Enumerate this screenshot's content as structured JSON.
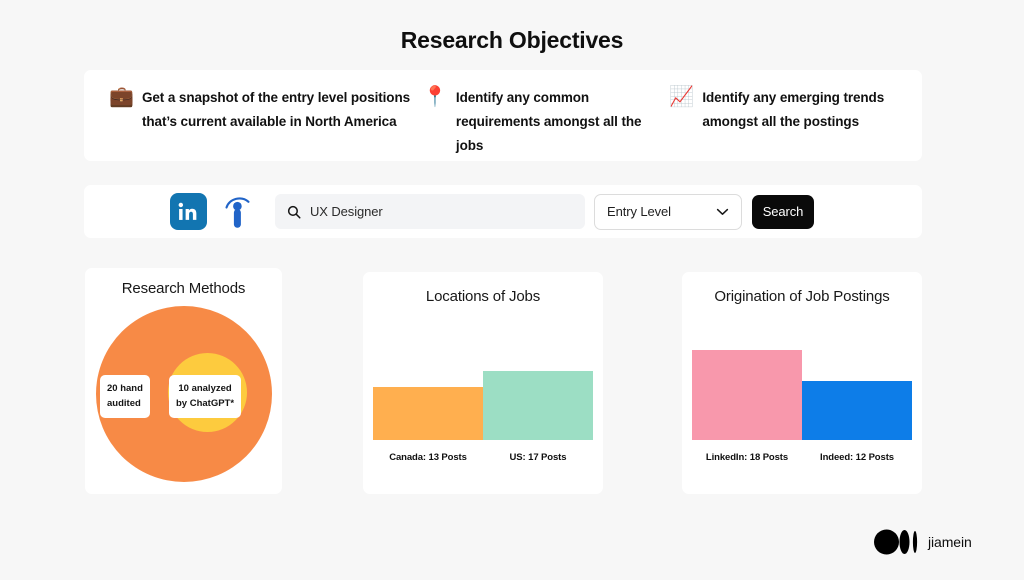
{
  "page": {
    "title": "Research Objectives",
    "background_color": "#F7F7F7"
  },
  "objectives": {
    "items": [
      {
        "icon": "briefcase-emoji",
        "glyph": "💼",
        "text": "Get a snapshot of the entry level positions that’s current available in North America"
      },
      {
        "icon": "pushpin-emoji",
        "glyph": "📍",
        "text": "Identify any common requirements amongst all the jobs"
      },
      {
        "icon": "chart-increasing-emoji",
        "glyph": "📈",
        "text": "Identify any emerging trends amongst all the postings"
      }
    ]
  },
  "search_bar": {
    "logos": [
      {
        "name": "linkedin-logo",
        "label": "in",
        "color": "#1275B1"
      },
      {
        "name": "indeed-logo",
        "label": "i",
        "color": "#2164C8"
      }
    ],
    "search_icon": "search-icon",
    "query_value": "UX Designer",
    "query_placeholder": "UX Designer",
    "level_selected": "Entry Level",
    "level_options": [
      "Entry Level"
    ],
    "chevron_icon": "chevron-down-icon",
    "search_button_label": "Search"
  },
  "chart_data": [
    {
      "type": "pie",
      "name": "research-methods",
      "title": "Research Methods",
      "categories": [
        "20 hand audited",
        "10 analyzed by ChatGPT*"
      ],
      "values": [
        20,
        10
      ],
      "labels": [
        "20 hand\naudited",
        "10 analyzed\nby ChatGPT*"
      ],
      "colors": [
        "#F78A46",
        "#FDCB3E"
      ],
      "layout": "nested-circles",
      "legend": "inline-labels",
      "grid": false
    },
    {
      "type": "bar",
      "name": "locations-of-jobs",
      "title": "Locations of Jobs",
      "categories": [
        "Canada",
        "US"
      ],
      "values": [
        13,
        17
      ],
      "labels": [
        "Canada: 13 Posts",
        "US: 17 Posts"
      ],
      "colors": [
        "#FFAF4F",
        "#9CDEC4"
      ],
      "xlabel": "",
      "ylabel": "Posts",
      "ylim": [
        0,
        17
      ],
      "grid": false,
      "legend": "none"
    },
    {
      "type": "bar",
      "name": "origination-of-job-postings",
      "title": "Origination of Job Postings",
      "categories": [
        "LinkedIn",
        "Indeed"
      ],
      "values": [
        18,
        12
      ],
      "labels": [
        "LinkedIn: 18 Posts",
        "Indeed: 12 Posts"
      ],
      "colors": [
        "#F898AC",
        "#0D7DE8"
      ],
      "xlabel": "",
      "ylabel": "Posts",
      "ylim": [
        0,
        18
      ],
      "grid": false,
      "legend": "none"
    }
  ],
  "footer": {
    "logo": "medium-logo",
    "author": "jiamein"
  }
}
